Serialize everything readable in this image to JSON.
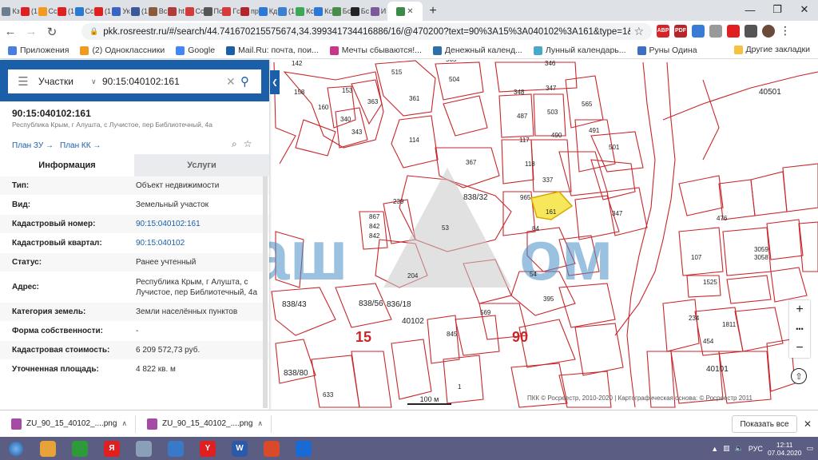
{
  "browser": {
    "tabs": [
      {
        "label": "Кз",
        "color": "#6b7d8f"
      },
      {
        "label": "(1",
        "color": "#e02020"
      },
      {
        "label": "Сс",
        "color": "#f09a1e"
      },
      {
        "label": "(1",
        "color": "#e02020"
      },
      {
        "label": "Сс",
        "color": "#2a7ad4"
      },
      {
        "label": "(1",
        "color": "#e02020"
      },
      {
        "label": "Ук",
        "color": "#3b63c6"
      },
      {
        "label": "(1",
        "color": "#3b5998"
      },
      {
        "label": "Вс",
        "color": "#8a5a3a"
      },
      {
        "label": "ht",
        "color": "#b13a3a"
      },
      {
        "label": "Сс",
        "color": "#d53b3b"
      },
      {
        "label": "Пс",
        "color": "#555555"
      },
      {
        "label": "Гс",
        "color": "#d63a3a"
      },
      {
        "label": "пр",
        "color": "#b2262b"
      },
      {
        "label": "Кд",
        "color": "#2b78d6"
      },
      {
        "label": "(1",
        "color": "#3a7fd0"
      },
      {
        "label": "Кс",
        "color": "#3aa857"
      },
      {
        "label": "Кс",
        "color": "#2b78d6"
      },
      {
        "label": "Бс",
        "color": "#4a8d4a"
      },
      {
        "label": "Бс",
        "color": "#222222"
      },
      {
        "label": "И",
        "color": "#7a5a9a"
      }
    ],
    "url": "pkk.rosreestr.ru/#/search/44.741670215575674,34.399341734416886/16/@470200?text=90%3A15%3A040102%3A161&type=1&opened=...",
    "new_tab_symbol": "+",
    "win_controls": [
      "—",
      "❐",
      "✕"
    ]
  },
  "extensions": [
    {
      "label": "ABP",
      "color": "#d8222a"
    },
    {
      "label": "PDF",
      "color": "#b5252a"
    },
    {
      "label": "",
      "color": "#3a7bd5"
    },
    {
      "label": "",
      "color": "#9a9a9a"
    },
    {
      "label": "",
      "color": "#e02020"
    },
    {
      "label": "",
      "color": "#555555"
    }
  ],
  "bookmarks": [
    {
      "label": "Приложения",
      "color": "#4a7de0"
    },
    {
      "label": "(2) Одноклассники",
      "color": "#f09a1e"
    },
    {
      "label": "Google",
      "color": "#4285f4"
    },
    {
      "label": "Mail.Ru: почта, пои...",
      "color": "#1a5fa8"
    },
    {
      "label": "Мечты сбываются!...",
      "color": "#c8358a"
    },
    {
      "label": "Денежный календ...",
      "color": "#2d6fa8"
    },
    {
      "label": "Лунный календарь...",
      "color": "#4aa9c9"
    },
    {
      "label": "Руны Одина",
      "color": "#3d6fc2"
    }
  ],
  "bookmarks_other": "Другие закладки",
  "search": {
    "mode": "Участки",
    "query": "90:15:040102:161"
  },
  "object": {
    "title": "90:15:040102:161",
    "subtitle": "Республика Крым, г Алушта, с Лучистое, пер Библиотечный, 4а",
    "plan_zu": "План ЗУ →",
    "plan_kk": "План КК →"
  },
  "tabs_panel": {
    "info": "Информация",
    "services": "Услуги"
  },
  "info_rows": [
    {
      "label": "Тип:",
      "value": "Объект недвижимости",
      "link": false
    },
    {
      "label": "Вид:",
      "value": "Земельный участок",
      "link": false
    },
    {
      "label": "Кадастровый номер:",
      "value": "90:15:040102:161",
      "link": true
    },
    {
      "label": "Кадастровый квартал:",
      "value": "90:15:040102",
      "link": true
    },
    {
      "label": "Статус:",
      "value": "Ранее учтенный",
      "link": false
    },
    {
      "label": "Адрес:",
      "value": "Республика Крым, г Алушта, с Лучистое, пер Библиотечный, 4а",
      "link": false
    },
    {
      "label": "Категория земель:",
      "value": "Земли населённых пунктов",
      "link": false
    },
    {
      "label": "Форма собственности:",
      "value": "-",
      "link": false
    },
    {
      "label": "Кадастровая стоимость:",
      "value": "6 209 572,73 руб.",
      "link": false
    },
    {
      "label": "Уточненная площадь:",
      "value": "4 822 кв. м",
      "link": false
    }
  ],
  "map": {
    "parcel_labels": [
      [
        "142",
        365,
        82
      ],
      [
        "515",
        490,
        93
      ],
      [
        "565",
        558,
        77
      ],
      [
        "346",
        682,
        82
      ],
      [
        "158",
        368,
        118
      ],
      [
        "153",
        428,
        116
      ],
      [
        "363",
        460,
        130
      ],
      [
        "504",
        562,
        102
      ],
      [
        "361",
        512,
        126
      ],
      [
        "160",
        398,
        137
      ],
      [
        "340",
        426,
        152
      ],
      [
        "343",
        440,
        168
      ],
      [
        "114",
        512,
        178
      ],
      [
        "348",
        643,
        118
      ],
      [
        "347",
        683,
        113
      ],
      [
        "487",
        647,
        148
      ],
      [
        "503",
        685,
        143
      ],
      [
        "565",
        728,
        133
      ],
      [
        "491",
        737,
        166
      ],
      [
        "40501",
        950,
        118
      ],
      [
        "117",
        650,
        178
      ],
      [
        "490",
        690,
        172
      ],
      [
        "501",
        762,
        187
      ],
      [
        "367",
        583,
        206
      ],
      [
        "118",
        657,
        208
      ],
      [
        "337",
        679,
        228
      ],
      [
        "838/32",
        580,
        250
      ],
      [
        "239",
        492,
        255
      ],
      [
        "965",
        651,
        250
      ],
      [
        "161",
        683,
        268
      ],
      [
        "347",
        766,
        270
      ],
      [
        "476",
        897,
        276
      ],
      [
        "53",
        553,
        288
      ],
      [
        "867",
        462,
        274
      ],
      [
        "842",
        462,
        286
      ],
      [
        "842",
        462,
        298
      ],
      [
        "84",
        666,
        289
      ],
      [
        "107",
        865,
        325
      ],
      [
        "3059",
        944,
        315
      ],
      [
        "3058",
        944,
        325
      ],
      [
        "1525",
        880,
        356
      ],
      [
        "204",
        510,
        348
      ],
      [
        "54",
        663,
        346
      ],
      [
        "395",
        680,
        377
      ],
      [
        "836/18",
        484,
        384
      ],
      [
        "838/43",
        353,
        384
      ],
      [
        "838/56",
        449,
        383
      ],
      [
        "234",
        862,
        401
      ],
      [
        "40102",
        503,
        405
      ],
      [
        "569",
        601,
        394
      ],
      [
        "1811",
        904,
        409
      ],
      [
        "15",
        445,
        428
      ],
      [
        "90",
        641,
        428
      ],
      [
        "454",
        880,
        430
      ],
      [
        "845",
        559,
        421
      ],
      [
        "40101",
        884,
        465
      ],
      [
        "838/80",
        355,
        470
      ],
      [
        "633",
        404,
        497
      ],
      [
        "1",
        573,
        487
      ]
    ]
  },
  "scale": "100 м",
  "copyright": "ПКК © Росреестр, 2010-2020 | Картографическая основа: © Росреестр 2011",
  "map_controls": {
    "zoom_in": "+",
    "more": "•••",
    "zoom_out": "−",
    "compass": "⇧"
  },
  "downloads": [
    {
      "label": "ZU_90_15_40102_....png"
    },
    {
      "label": "ZU_90_15_40102_....png"
    }
  ],
  "show_all": "Показать все",
  "taskbar": {
    "apps": [
      {
        "label": "",
        "color": "#e8a23a"
      },
      {
        "label": "",
        "color": "#2f9a3a"
      },
      {
        "label": "Я",
        "color": "#e02020"
      },
      {
        "label": "",
        "color": "#8aa0b8"
      },
      {
        "label": "",
        "color": "#3a78c8"
      },
      {
        "label": "Y",
        "color": "#e02020"
      },
      {
        "label": "W",
        "color": "#2b5aa8"
      },
      {
        "label": "",
        "color": "#d84a2a"
      },
      {
        "label": "",
        "color": "#1a6ad6"
      }
    ],
    "lang": "РУС",
    "time": "12:11",
    "date": "07.04.2020"
  }
}
